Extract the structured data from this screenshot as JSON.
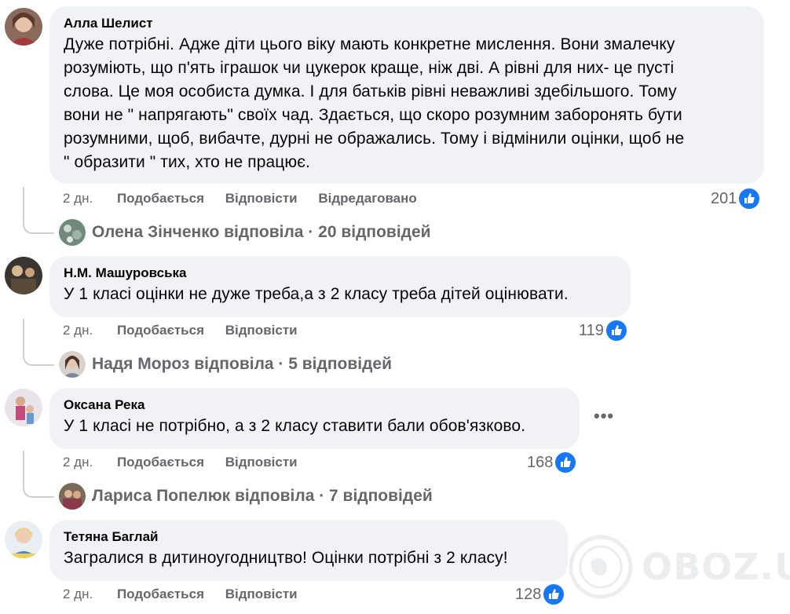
{
  "comments": [
    {
      "author": "Алла Шелист",
      "text_lines": [
        "Дуже потрібні. Адже діти цього віку мають конкретне мислення. Вони змалечку",
        "розуміють, що п'ять іграшок чи цукерок краще, ніж дві. А рівні для них- це пусті",
        "слова. Це моя особиста думка. І для батьків рівні неважливі здебільшого. Тому",
        "вони не \" напрягають\" своїх чад. Здається, що скоро розумним заборонять бути",
        "розумними, щоб, вибачте, дурні не ображались. Тому і відмінили оцінки, щоб не",
        "\" образити \" тих, хто не працює."
      ],
      "time": "2 дн.",
      "like_label": "Подобається",
      "reply_label": "Відповісти",
      "edited_label": "Відредаговано",
      "reactions": "201",
      "replies_summary": "Олена Зінченко відповіла · 20 відповідей"
    },
    {
      "author": "Н.М. Машуровська",
      "text": "У 1 класі оцінки не дуже треба,а з 2 класу треба дітей оцінювати.",
      "time": "2 дн.",
      "like_label": "Подобається",
      "reply_label": "Відповісти",
      "reactions": "119",
      "replies_summary": "Надя Мороз відповіла · 5 відповідей"
    },
    {
      "author": "Оксана Река",
      "text": "У 1 класі не потрібно, а з 2 класу ставити бали обов'язково.",
      "time": "2 дн.",
      "like_label": "Подобається",
      "reply_label": "Відповісти",
      "reactions": "168",
      "replies_summary": "Лариса Попелюк відповіла · 7 відповідей",
      "more_icon": "more-horizontal-icon"
    },
    {
      "author": "Тетяна Баглай",
      "text": "Загралися в дитиноугодництво! Оцінки потрібні з 2 класу!",
      "time": "2 дн.",
      "like_label": "Подобається",
      "reply_label": "Відповісти",
      "reactions": "128"
    }
  ],
  "icons": {
    "like": "thumbs-up-icon",
    "more": "more-horizontal-icon",
    "watermark": "globe-logo-icon"
  },
  "colors": {
    "bubble": "#f0f2f5",
    "meta_text": "#65676b",
    "like_blue": "#1877f2"
  },
  "watermark": "OBOZ.UA"
}
